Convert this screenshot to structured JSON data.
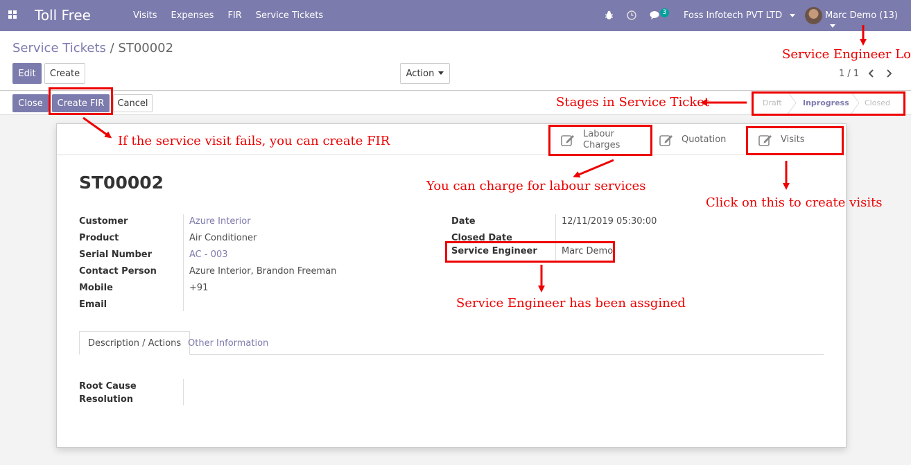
{
  "navbar": {
    "brand": "Toll Free",
    "menu": [
      "Visits",
      "Expenses",
      "FIR",
      "Service Tickets"
    ],
    "chat_count": "3",
    "company": "Foss Infotech PVT LTD",
    "user": "Marc Demo (13)"
  },
  "breadcrumb": {
    "parent": "Service Tickets",
    "separator": " / ",
    "current": "ST00002"
  },
  "toolbar": {
    "edit": "Edit",
    "create": "Create",
    "action": "Action",
    "pager": "1 / 1"
  },
  "statusbar": {
    "buttons": {
      "close": "Close",
      "create_fir": "Create FIR",
      "cancel": "Cancel"
    },
    "stages": [
      "Draft",
      "Inprogress",
      "Closed"
    ],
    "active_stage": "Inprogress"
  },
  "smart_buttons": {
    "labour_1": "Labour",
    "labour_2": "Charges",
    "quotation": "Quotation",
    "visits": "Visits"
  },
  "form": {
    "title": "ST00002",
    "left": [
      {
        "label": "Customer",
        "value": "Azure Interior"
      },
      {
        "label": "Product",
        "value": "Air Conditioner"
      },
      {
        "label": "Serial Number",
        "value": "AC - 003"
      },
      {
        "label": "Contact Person",
        "value": "Azure Interior, Brandon Freeman"
      },
      {
        "label": "Mobile",
        "value": "+91"
      },
      {
        "label": "Email",
        "value": ""
      }
    ],
    "right": [
      {
        "label": "Date",
        "value": "12/11/2019 05:30:00"
      },
      {
        "label": "Closed Date",
        "value": ""
      },
      {
        "label": "Service Engineer",
        "value": "Marc Demo"
      }
    ],
    "tabs": [
      "Description / Actions",
      "Other Information"
    ],
    "root_cause_1": "Root Cause",
    "root_cause_2": "Resolution"
  },
  "annotations": {
    "login": "Service Engineer Login",
    "stages": "Stages in Service Ticket",
    "fir": "If the service visit fails, you can create FIR",
    "labour": "You can charge for labour services",
    "visits": "Click on this to create visits",
    "engineer": "Service Engineer has been assgined"
  },
  "colors": {
    "primary": "#7c7bad",
    "annotation": "#e00000",
    "teal": "#00a09d"
  }
}
